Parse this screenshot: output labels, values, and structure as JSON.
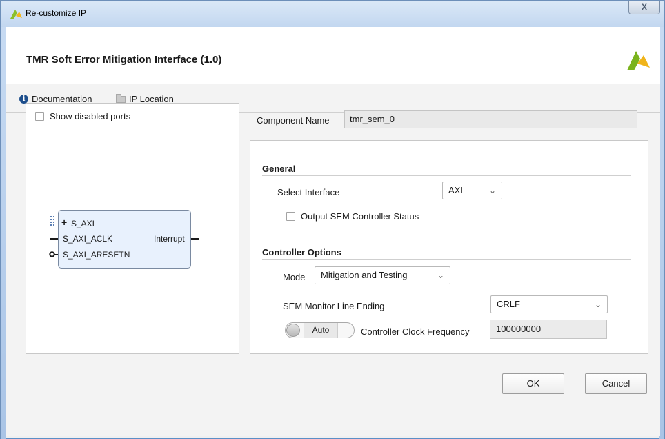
{
  "window": {
    "title": "Re-customize IP",
    "close_label": "X"
  },
  "header": {
    "title": "TMR Soft Error Mitigation Interface (1.0)"
  },
  "links": {
    "documentation": "Documentation",
    "ip_location": "IP Location"
  },
  "symbol_panel": {
    "show_disabled_ports_label": "Show disabled ports",
    "show_disabled_ports_checked": false,
    "ports_left": [
      "S_AXI",
      "S_AXI_ACLK",
      "S_AXI_ARESETN"
    ],
    "ports_right": [
      "Interrupt"
    ],
    "expand_symbol": "+"
  },
  "component": {
    "label": "Component Name",
    "value": "tmr_sem_0"
  },
  "general": {
    "title": "General",
    "select_interface_label": "Select Interface",
    "select_interface_value": "AXI",
    "output_status_label": "Output SEM Controller Status",
    "output_status_checked": false
  },
  "controller_options": {
    "title": "Controller Options",
    "mode_label": "Mode",
    "mode_value": "Mitigation and Testing",
    "line_ending_label": "SEM Monitor Line Ending",
    "line_ending_value": "CRLF",
    "auto_toggle_label": "Auto",
    "clock_freq_label": "Controller Clock Frequency",
    "clock_freq_value": "100000000"
  },
  "footer": {
    "ok_label": "OK",
    "cancel_label": "Cancel"
  },
  "colors": {
    "accent": "#1d4e8c",
    "ip_block_fill": "#e8f1fd",
    "logo_green": "#7ab31c",
    "logo_yellow": "#f0b41a"
  }
}
